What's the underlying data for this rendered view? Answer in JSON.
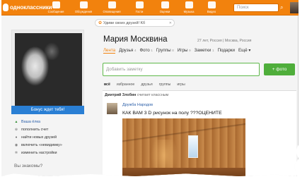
{
  "topbar": {
    "logo": "одноклассники",
    "nav": [
      {
        "label": "Сообщения",
        "icon": "envelope-icon"
      },
      {
        "label": "Обсуждения",
        "icon": "chat-icon"
      },
      {
        "label": "Оповещения",
        "icon": "bell-icon"
      },
      {
        "label": "Гости",
        "icon": "footprints-icon"
      },
      {
        "label": "Оценки",
        "icon": "star-icon"
      },
      {
        "label": "Музыка",
        "icon": "music-icon"
      },
      {
        "label": "Видео",
        "icon": "video-icon"
      }
    ],
    "search_placeholder": "Поиск",
    "accent": "#f2820d"
  },
  "gift_banner": {
    "text": "Удиви своих друзей! Kб"
  },
  "left": {
    "bonus_label": "Бонус ждет тебя!",
    "links": [
      {
        "label": "Ваша ёлка",
        "icon": "tree-icon"
      },
      {
        "label": "пополнить счет",
        "icon": "plus-icon"
      },
      {
        "label": "найти новых друзей",
        "icon": "people-icon"
      },
      {
        "label": "включить «невидимку»",
        "icon": "eye-icon"
      },
      {
        "label": "изменить настройки",
        "icon": "gear-icon"
      }
    ],
    "know_title": "Вы знакомы?"
  },
  "profile": {
    "name": "Мария Москвина",
    "meta": "27 лет, Россия | Москва, Россия",
    "tabs": [
      {
        "label": "Лента",
        "count": ""
      },
      {
        "label": "Друзья",
        "count": "4"
      },
      {
        "label": "Фото",
        "count": "1"
      },
      {
        "label": "Группы",
        "count": "8"
      },
      {
        "label": "Игры",
        "count": "9"
      },
      {
        "label": "Заметки",
        "count": "1"
      },
      {
        "label": "Подарки",
        "count": ""
      },
      {
        "label": "Ещё ▾",
        "count": ""
      }
    ]
  },
  "composer": {
    "placeholder": "Добавить заметку",
    "photo_button": "+ фото"
  },
  "filters": [
    "всё",
    "избранное",
    "друзья",
    "группы",
    "игры"
  ],
  "feed": {
    "meta_author": "Дмитрий Злобин",
    "meta_action": "считает классным",
    "group": "Дружба Народов",
    "text": "КАК ВАМ 3 D рисунок на полу ???ОЦЕНИТЕ"
  }
}
